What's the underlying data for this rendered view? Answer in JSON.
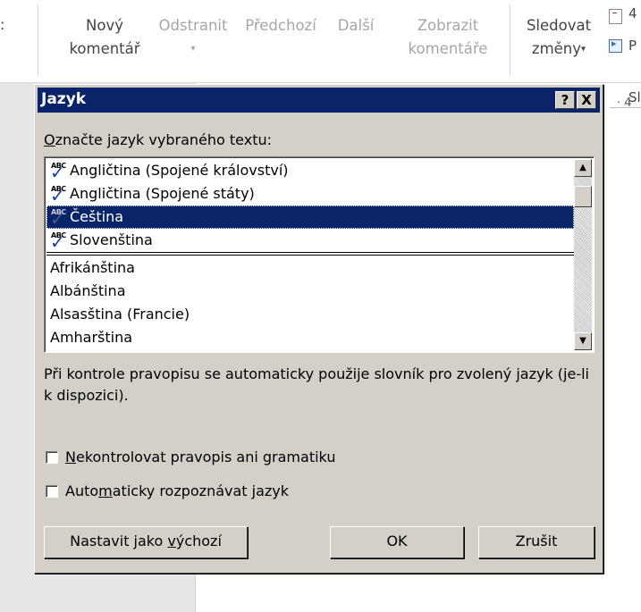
{
  "ribbon": {
    "left_glyph": ":",
    "new_comment": {
      "line1": "Nový",
      "line2": "komentář"
    },
    "delete": {
      "line1": "Odstranit",
      "line2": "▾"
    },
    "previous": {
      "line1": "Předchozí"
    },
    "next": {
      "line1": "Další"
    },
    "show_comments": {
      "line1": "Zobrazit",
      "line2": "komentáře"
    },
    "track_changes": {
      "line1": "Sledovat",
      "line2": "změny",
      "caret": "▾"
    },
    "edge_text_1": "4",
    "edge_text_2": "P",
    "edge_text_3": "Sl",
    "ruler_number": "· 4"
  },
  "dialog": {
    "title": "Jazyk",
    "help_label": "?",
    "close_label": "X",
    "prompt": "Označte jazyk vybraného textu:",
    "spell_badge": "ABC",
    "check_glyph": "✓",
    "favorite_languages": [
      "Angličtina (Spojené království)",
      "Angličtina (Spojené státy)",
      "Čeština",
      "Slovenština"
    ],
    "selected_index": 2,
    "other_languages": [
      "Afrikánština",
      "Albánština",
      "Alsasština (Francie)",
      "Amharština"
    ],
    "scroll_up": "▲",
    "scroll_down": "▼",
    "info_text": "Při kontrole pravopisu se automaticky použije slovník pro zvolený jazyk (je-li k dispozici).",
    "checkbox_no_proofing": {
      "label": "Nekontrolovat pravopis ani gramatiku",
      "checked": false
    },
    "checkbox_auto_detect": {
      "label": "Automaticky rozpoznávat jazyk",
      "checked": false
    },
    "btn_set_default": "Nastavit jako výchozí",
    "btn_ok": "OK",
    "btn_cancel": "Zrušit"
  },
  "colors": {
    "title_bar": "#0a246a",
    "dialog_face": "#d4d0c8",
    "selection": "#0a246a",
    "checkmark": "#1a3fa6"
  }
}
